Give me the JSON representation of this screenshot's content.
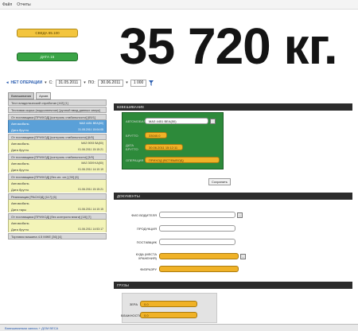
{
  "menu": [
    "Файл",
    "Отчеты"
  ],
  "buttons": {
    "yellow_label": "СВЕДА 85.100",
    "green_label": "ДАТА 15"
  },
  "weight_display": "35 720 кг.",
  "filter": {
    "no_ops_label": "НЕТ ОПЕРАЦИИ",
    "from_label": "С:",
    "from_date": "31.05.2011",
    "to_label": "ПО:",
    "to_date": "30.06.2011",
    "limit": "1 000"
  },
  "tabs": [
    "Взвешивания",
    "Архив"
  ],
  "left_list": [
    {
      "type": "hdr",
      "text": "Тест владельческий отработан [4/2] [1]"
    },
    {
      "type": "hdr",
      "text": "Тестовая сырья (подсолнечное) [ручной ввод данных сверк]"
    },
    {
      "type": "hdr",
      "text": "От поставщика [ПРИХОД] [контроль стабильности] [65/1]"
    },
    {
      "type": "item",
      "sel": true,
      "a": "Автомобиль",
      "b": "МАЗ 4451 ВЕА(50)"
    },
    {
      "type": "item",
      "sel": true,
      "a": "Дата брутто",
      "b": "31.05.2011 15:04:05"
    },
    {
      "type": "hdr",
      "text": "От поставщика [ПРИХОД] [контроль стабильности] [6/5]"
    },
    {
      "type": "item",
      "a": "Автомобиль",
      "b": "МАЗ 9093 ВА(50)"
    },
    {
      "type": "item",
      "a": "Дата брутто",
      "b": "01.06.2011 15:15:21"
    },
    {
      "type": "hdr",
      "text": "От поставщика [ПРИХОД] [контроль стабильности] [3/9]"
    },
    {
      "type": "item",
      "a": "Автомобиль",
      "b": "МАЗ 3009 КА(50)"
    },
    {
      "type": "item",
      "a": "Дата брутто",
      "b": "01.06.2011 14:10:19"
    },
    {
      "type": "hdr",
      "text": "От поставщика [ПРИХОД] [без ил. ил.] [30] [6]"
    },
    {
      "type": "item",
      "a": "Автомобиль",
      "b": ""
    },
    {
      "type": "item",
      "a": "Дата брутто",
      "b": "01.06.2011 15:15:21"
    },
    {
      "type": "hdr",
      "text": "Реализация [РАСХОД] [117] [6]"
    },
    {
      "type": "item",
      "a": "Автомобиль",
      "b": ""
    },
    {
      "type": "item",
      "a": "Дата тары",
      "b": "01.06.2011 14:10:15"
    },
    {
      "type": "hdr",
      "text": "От поставщика [ПРИХОД] [без контроля влаги] [18] [7]"
    },
    {
      "type": "item",
      "a": "Автомобиль",
      "b": ""
    },
    {
      "type": "item",
      "a": "Дата брутто",
      "b": "01.06.2011 14:53:17"
    },
    {
      "type": "hdr",
      "text": "Торговая машина 4.5 МЖЕ [36] [4]"
    }
  ],
  "sections": {
    "weighing": "ВЗВЕШИВАНИЕ",
    "documents": "ДОКУМЕНТЫ",
    "goods": "ГРУЗЫ"
  },
  "weighing_form": {
    "auto_label": "АВТОМОБИЛЬ",
    "auto_value": "МАЗ 4451 ВЕА(50)",
    "gross_label": "БРУТТО",
    "gross_value": "33040.0",
    "gross_date_label": "ДАТА БРУТТО",
    "gross_date_value": "30.06.2011 15:12:11",
    "operation_label": "ОПЕРАЦИЯ",
    "operation_value": "ПРИХОД (ВСТ/ВЫВОД)",
    "save_label": "Сохранить"
  },
  "documents_form": [
    {
      "label": "ФИО ВОДИТЕЛЯ",
      "style": "white"
    },
    {
      "label": "ПРОДУКЦИЯ",
      "style": "white"
    },
    {
      "label": "ПОСТАВЩИК",
      "style": "white"
    },
    {
      "label": "КУДА (МЕСТА ХРАНЕНИЯ)",
      "style": "yellow"
    },
    {
      "label": "ФИЗРАЗРУ",
      "style": "yellow"
    }
  ],
  "goods": [
    {
      "label": "ЗЕРА",
      "value": "0.0"
    },
    {
      "label": "ВЛАЖНОСТЬ",
      "value": "0.0"
    }
  ],
  "status": "Взвешиваемая запись + ДОМ ВЕСА"
}
